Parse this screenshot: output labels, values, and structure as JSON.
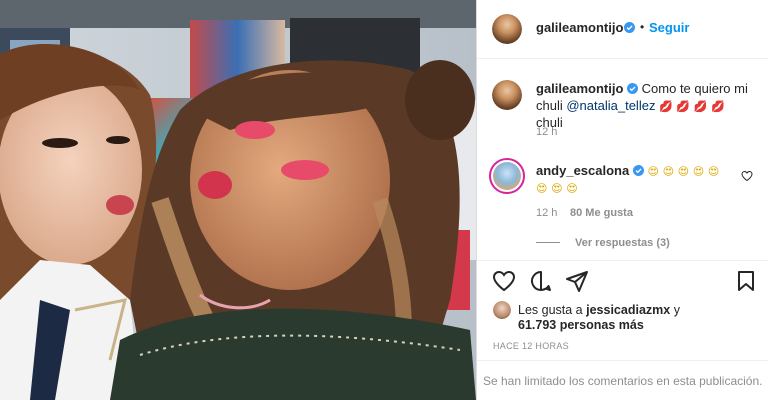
{
  "post": {
    "author": "galileamontijo",
    "follow_label": "Seguir",
    "separator": "•"
  },
  "caption": {
    "username": "galileamontijo",
    "text": "Como te quiero mi chuli",
    "mention": "@natalia_tellez",
    "emojis": [
      "💋",
      "💋",
      "💋",
      "💋"
    ],
    "time": "12 h"
  },
  "comment": {
    "username": "andy_escalona",
    "emojis_line1": [
      "😍",
      "😍",
      "😍",
      "😍",
      "😍"
    ],
    "emojis_line2": [
      "😍",
      "😍",
      "😍"
    ],
    "time": "12 h",
    "likes": "80 Me gusta",
    "replies": "Ver respuestas (3)"
  },
  "likes": {
    "prefix": "Les gusta a",
    "user": "jessicadiazmx",
    "connector": "y",
    "count": "61.793 personas más"
  },
  "timestamp": "HACE 12 HORAS",
  "comments_limited": "Se han limitado los comentarios en esta publicación.",
  "icons": [
    "heart-icon",
    "comment-icon",
    "share-icon",
    "bookmark-icon",
    "verified-icon",
    "small-heart-icon"
  ],
  "colors": {
    "link": "#0095f6",
    "verified": "#3897f0",
    "muted": "#8e8e8e",
    "ring": "#d6249f"
  }
}
